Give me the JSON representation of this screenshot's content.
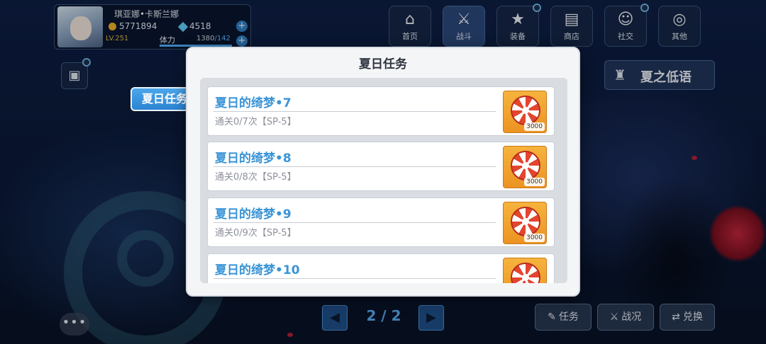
{
  "player": {
    "name": "琪亚娜•卡斯兰娜",
    "coins": "5771894",
    "gems": "4518",
    "level": "LV.251",
    "stamina_label": "体力",
    "stamina_current": "1380",
    "stamina_max": "/142",
    "stamina_fill_fraction": 1.0
  },
  "nav": {
    "items": [
      {
        "label": "首页",
        "icon": "home-icon",
        "glyph": "⌂"
      },
      {
        "label": "战斗",
        "icon": "battle-icon",
        "glyph": "⚔"
      },
      {
        "label": "装备",
        "icon": "equipment-icon",
        "glyph": "★"
      },
      {
        "label": "商店",
        "icon": "shop-icon",
        "glyph": "▤"
      },
      {
        "label": "社交",
        "icon": "social-icon",
        "glyph": "☺"
      },
      {
        "label": "其他",
        "icon": "other-icon",
        "glyph": "◎"
      }
    ]
  },
  "event_banner": {
    "label": "夏之低语"
  },
  "modal": {
    "title": "夏日任务",
    "side_tab": "夏日任务",
    "missions": [
      {
        "name": "夏日的绮梦•7",
        "progress": "通关0/7次【SP-5】",
        "reward_count": "3000"
      },
      {
        "name": "夏日的绮梦•8",
        "progress": "通关0/8次【SP-5】",
        "reward_count": "3000"
      },
      {
        "name": "夏日的绮梦•9",
        "progress": "通关0/9次【SP-5】",
        "reward_count": "3000"
      },
      {
        "name": "夏日的绮梦•10",
        "progress": "",
        "reward_count": ""
      }
    ]
  },
  "pager": {
    "text": "2 / 2"
  },
  "bottom": {
    "mission_label": "任务",
    "status_label": "战况",
    "exchange_label": "兑换"
  },
  "colors": {
    "accent": "#3a94d6",
    "reward_bg": "#f0a02d",
    "modal_bg": "#f4f5f7"
  }
}
